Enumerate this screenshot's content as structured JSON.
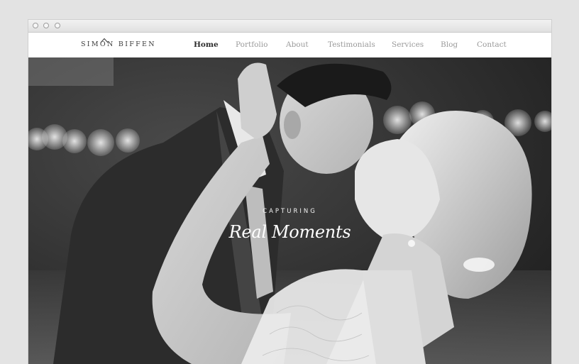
{
  "window": {
    "controls": [
      "close",
      "minimize",
      "maximize"
    ]
  },
  "site": {
    "logo_text": "SIMON BIFFEN",
    "nav": [
      {
        "label": "Home",
        "active": true
      },
      {
        "label": "Portfolio",
        "active": false
      },
      {
        "label": "About",
        "active": false
      },
      {
        "label": "Testimonials",
        "active": false
      },
      {
        "label": "Services",
        "active": false
      },
      {
        "label": "Blog",
        "active": false
      },
      {
        "label": "Contact",
        "active": false
      }
    ]
  },
  "hero": {
    "kicker": "CAPTURING",
    "title": "Real Moments",
    "image": "black-and-white wedding photo of a couple kissing"
  },
  "colors": {
    "page_bg": "#e3e3e3",
    "nav_active": "#2b2b2b",
    "nav_inactive": "#9a9a9a"
  }
}
